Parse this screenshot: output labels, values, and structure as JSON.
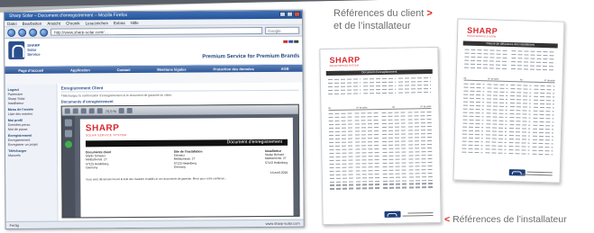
{
  "callouts": {
    "client_line1": "Références du client",
    "client_line2": "et de l’installateur",
    "installer": "Références de l’installateur",
    "arrow_right": ">",
    "arrow_left": "<"
  },
  "browser": {
    "title": "Sharp Solar – Document d’enregistrement – Mozilla Firefox",
    "menu": [
      "Datei",
      "Bearbeiten",
      "Ansicht",
      "Chronik",
      "Lesezeichen",
      "Extras",
      "Hilfe"
    ],
    "address": "http://www.sharp-solar.com/…",
    "search_placeholder": "Google",
    "status_left": "Fertig",
    "status_right": "www.sharp-solar.com"
  },
  "site": {
    "brand_line1": "SHARP",
    "brand_line2": "Solar",
    "brand_line3": "Service",
    "tagline": "Premium Service for Premium Brands",
    "nav": [
      "Page d’accueil",
      "Application",
      "Contact",
      "Mentions légales",
      "Protection des données",
      "AGB"
    ],
    "sidebar": {
      "head1": "Logout",
      "items1": [
        "Partenaire",
        "Sharp Solar",
        "Installateur"
      ],
      "head2": "Menu de l’entrée",
      "items2": [
        "Liste des entrées"
      ],
      "head3": "Moi profil",
      "items3": [
        "Données perso.",
        "Mot de passe"
      ],
      "head4": "Enregistrement",
      "items4": [
        "Enregistrement",
        "Enregistrer un projet"
      ],
      "head5": "Télécharger",
      "items5": [
        "Manuels"
      ]
    },
    "breadcrumb": "Enregistrement Client",
    "notice": "Téléchargez la confirmation d’enregistrement et le document de garantie du client.",
    "doc_label": "Documents d’enregistrement"
  },
  "pdf": {
    "zoom": "70,5 %",
    "logo": "SHARP",
    "logo_sub": "SOLAR SERVICE SYSTEM",
    "title": "Document d’enregistrement",
    "col1_head": "Documents client",
    "col1_lines": [
      "Martin Schwarz",
      "Mettlacherstr. 27",
      "57123 Heidelberg",
      "Germany"
    ],
    "col2_head": "Site de l’installation",
    "col2_lines": [
      "Schwarz",
      "Mettlacherstr. 27",
      "57123 Heidelberg",
      "Germany"
    ],
    "col3_head": "Installateur",
    "col3_lines": [
      "Stefan Behnert",
      "Mettlacherstr. 27",
      "57123 Heidelberg"
    ],
    "date": "14.avril.2010",
    "para": "Vous avez désormais trouvé la liste des modules installés et vos documents de garantie. Merci pour votre confiance…"
  },
  "doc1": {
    "logo": "SHARP",
    "sub": "SOLAR SERVICE SYSTEM",
    "title": "Document d’enregistrement",
    "table_cols": [
      "Nr.",
      "N° de série",
      "Nr.",
      "N° de série"
    ]
  },
  "doc2": {
    "logo": "SHARP",
    "sub": "SOLAR SERVICE SYSTEM",
    "title": "Preuve de délivrance des installations",
    "table_cols": [
      "Nr.",
      "N° de série",
      "Nr.",
      "N° de série"
    ]
  },
  "colors": {
    "sharp_red": "#d8282d",
    "brand_blue": "#2b4f8e",
    "arrow_red": "#e2231a"
  }
}
